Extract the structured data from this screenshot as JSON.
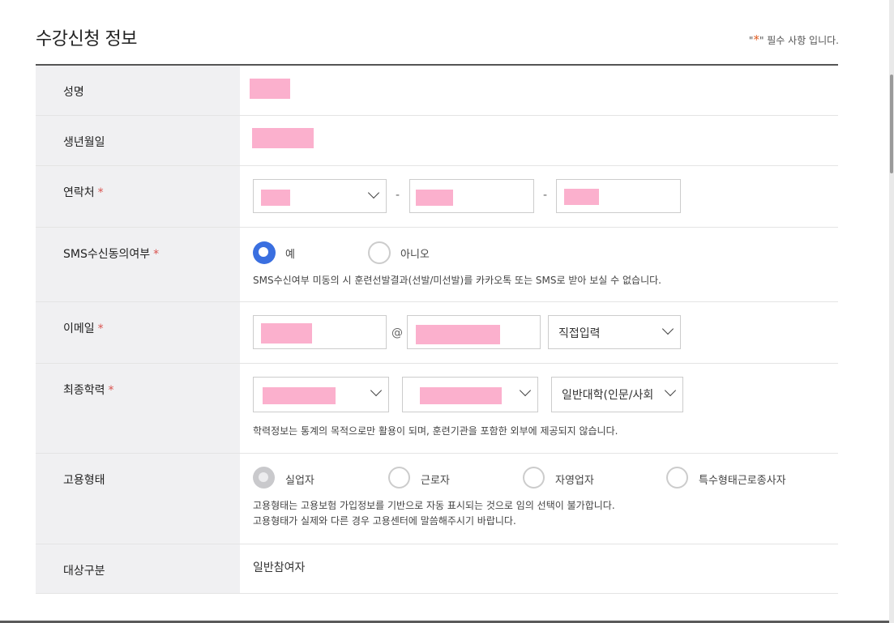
{
  "title": "수강신청 정보",
  "required_note": {
    "prefix": "\"",
    "star": "*",
    "suffix": "\" 필수 사항 입니다."
  },
  "rows": {
    "name": {
      "label": "성명"
    },
    "birth": {
      "label": "생년월일"
    },
    "contact": {
      "label": "연락처",
      "required_star": "*",
      "separator": "-"
    },
    "sms": {
      "label": "SMS수신동의여부",
      "required_star": "*",
      "options": [
        "예",
        "아니오"
      ],
      "selected": "예",
      "help": "SMS수신여부 미동의 시 훈련선발결과(선발/미선발)를 카카오톡 또는 SMS로 받아 보실 수 없습니다."
    },
    "email": {
      "label": "이메일",
      "required_star": "*",
      "at": "@",
      "domain_select": "직접입력"
    },
    "education": {
      "label": "최종학력",
      "required_star": "*",
      "type_select": "일반대학(인문/사회",
      "help": "학력정보는 통계의 목적으로만 활용이 되며, 훈련기관을 포함한 외부에 제공되지 않습니다."
    },
    "employment": {
      "label": "고용형태",
      "options": [
        "실업자",
        "근로자",
        "자영업자",
        "특수형태근로종사자"
      ],
      "selected": "실업자",
      "help_line1": "고용형태는 고용보험 가입정보를 기반으로 자동 표시되는 것으로 임의 선택이 불가합니다.",
      "help_line2": "고용형태가 실제와 다른 경우 고용센터에 말씀해주시기 바랍니다."
    },
    "target": {
      "label": "대상구분",
      "value": "일반참여자"
    }
  },
  "colors": {
    "accent": "#3a6fe0",
    "required": "#d9534f",
    "redaction": "#fbb0cd",
    "header_bg": "#f0f0f2"
  }
}
